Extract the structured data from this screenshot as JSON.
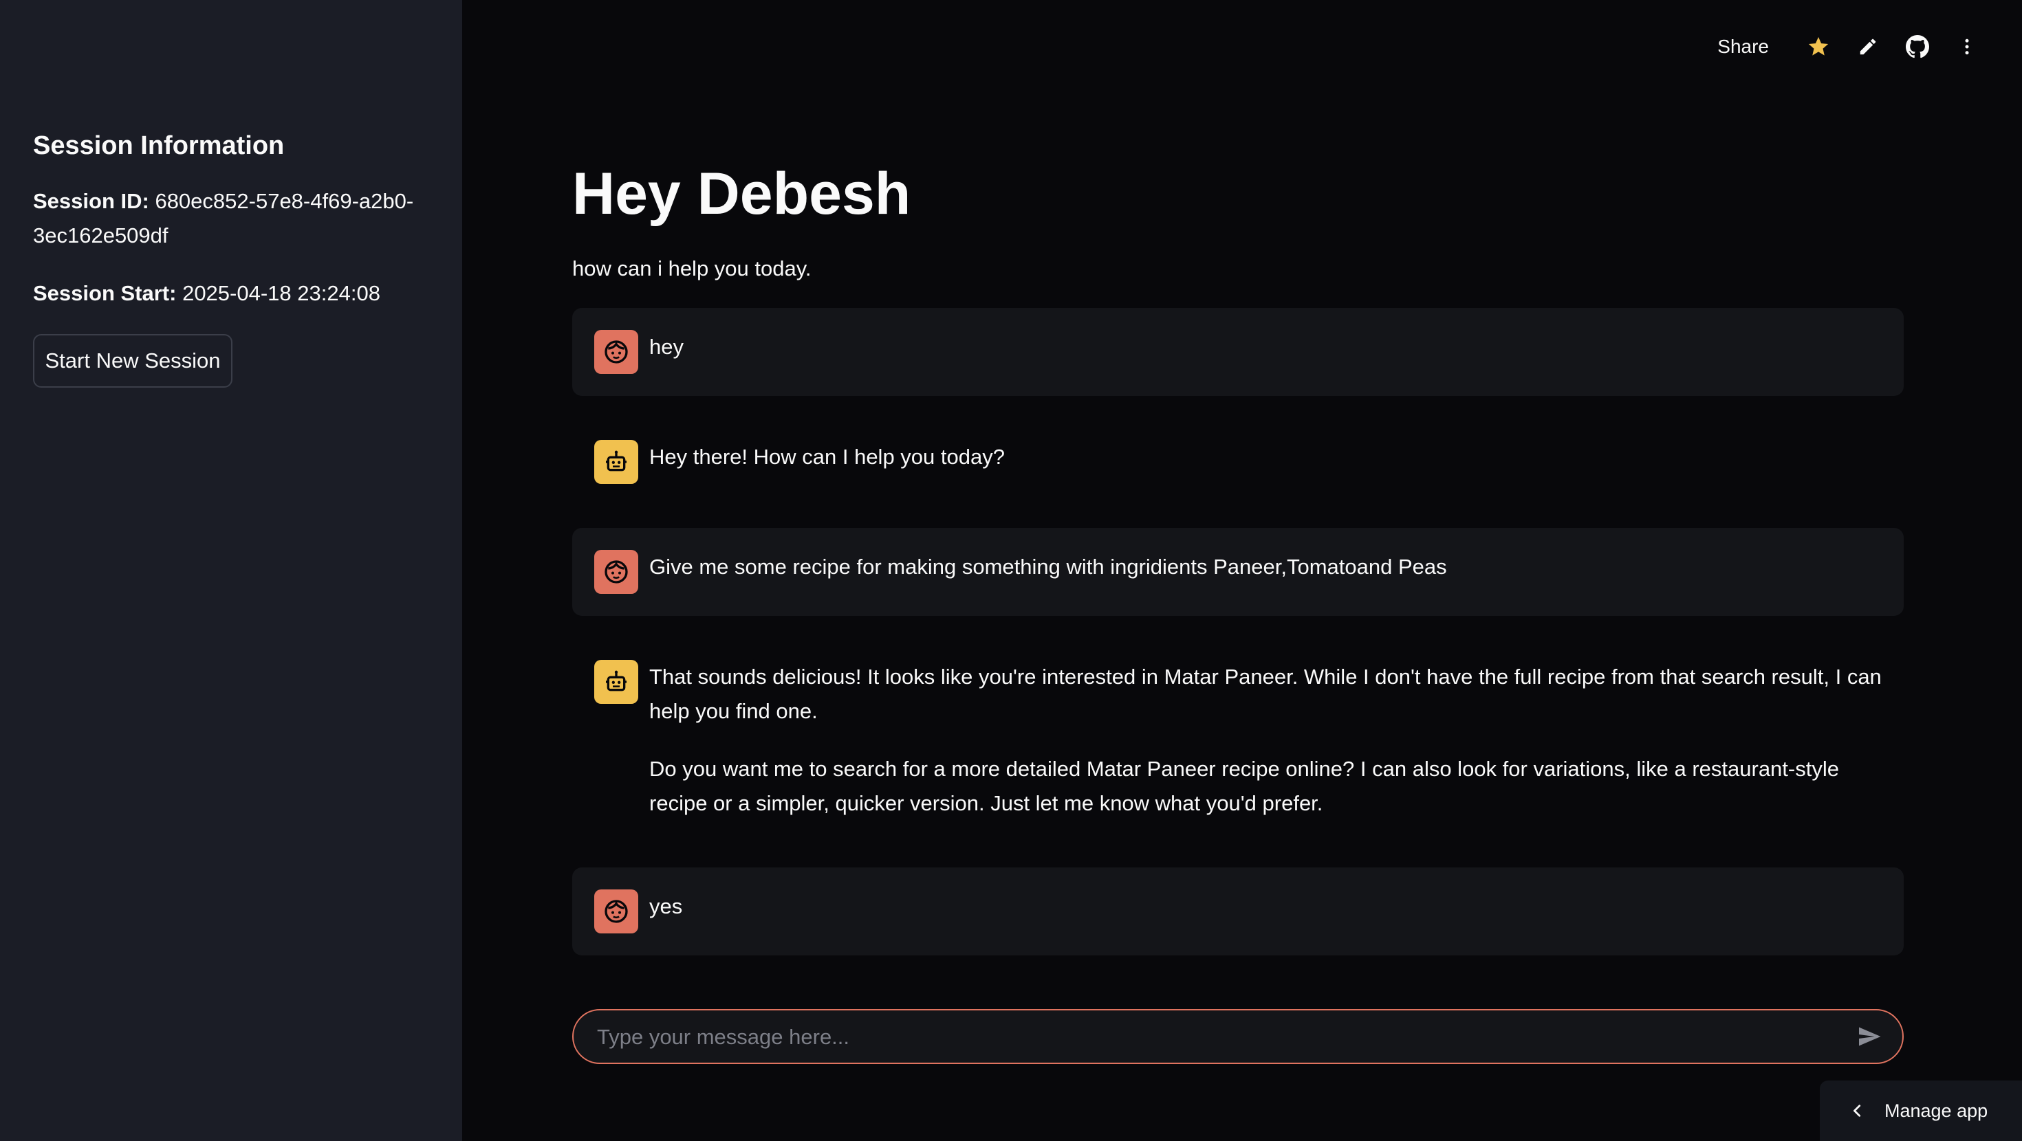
{
  "sidebar": {
    "heading": "Session Information",
    "session_id_label": "Session ID:",
    "session_id_value": "680ec852-57e8-4f69-a2b0-3ec162e509df",
    "session_start_label": "Session Start:",
    "session_start_value": "2025-04-18 23:24:08",
    "new_session_button": "Start New Session"
  },
  "toolbar": {
    "share_label": "Share",
    "icons": [
      "star-icon",
      "pencil-icon",
      "github-icon",
      "more-vertical-icon"
    ]
  },
  "main": {
    "title": "Hey Debesh",
    "subtitle": "how can i help you today."
  },
  "messages": [
    {
      "role": "user",
      "text": "hey"
    },
    {
      "role": "assistant",
      "text": "Hey there! How can I help you today?"
    },
    {
      "role": "user",
      "text": "Give me some recipe for making something with ingridients Paneer,Tomatoand Peas"
    },
    {
      "role": "assistant",
      "paragraphs": [
        "That sounds delicious! It looks like you're interested in Matar Paneer. While I don't have the full recipe from that search result, I can help you find one.",
        "Do you want me to search for a more detailed Matar Paneer recipe online? I can also look for variations, like a restaurant-style recipe or a simpler, quicker version. Just let me know what you'd prefer."
      ]
    },
    {
      "role": "user",
      "text": "yes"
    }
  ],
  "chat_input": {
    "placeholder": "Type your message here...",
    "value": ""
  },
  "footer": {
    "manage_app_label": "Manage app"
  },
  "colors": {
    "sidebar_bg": "#1b1d26",
    "main_bg": "#08080b",
    "user_avatar": "#e0735f",
    "bot_avatar": "#f1c14f",
    "input_border": "#e0735f",
    "star": "#f1c14f"
  }
}
